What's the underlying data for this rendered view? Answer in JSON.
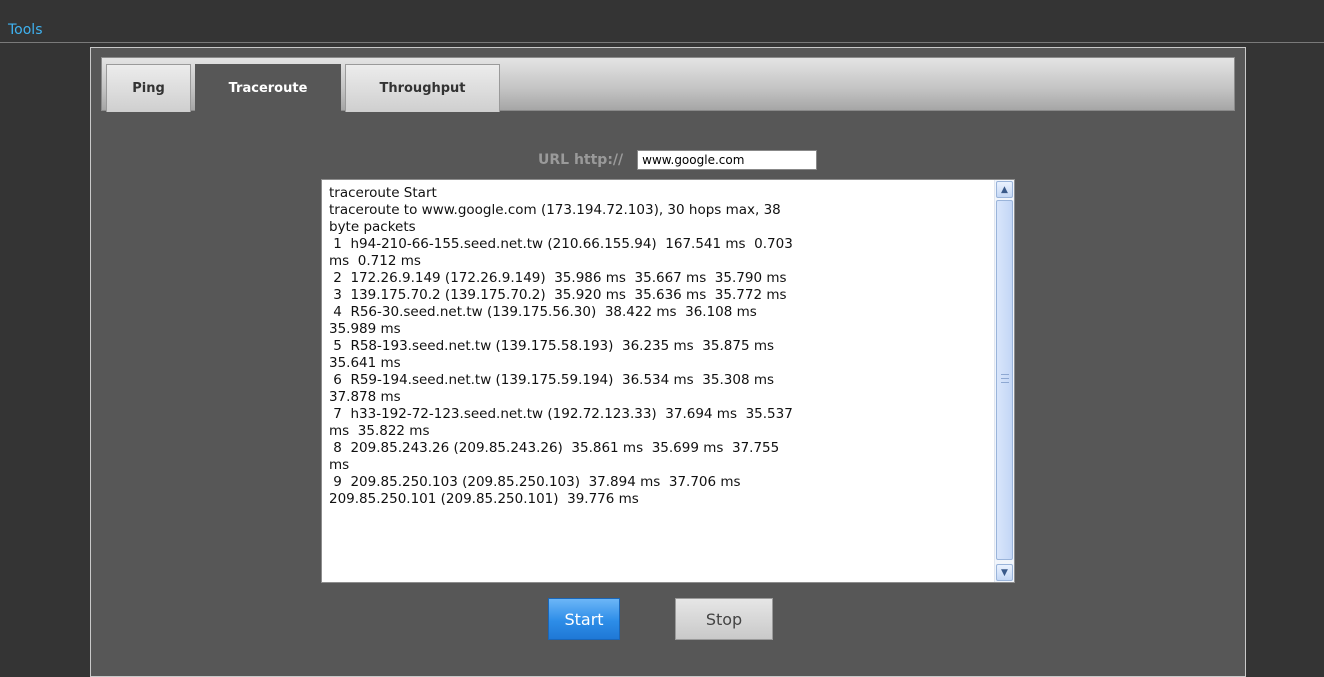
{
  "header": {
    "title": "Tools"
  },
  "tabs": [
    {
      "label": "Ping"
    },
    {
      "label": "Traceroute"
    },
    {
      "label": "Throughput"
    }
  ],
  "url": {
    "label": "URL http://",
    "value": "www.google.com"
  },
  "output_lines": [
    "traceroute Start",
    "traceroute to www.google.com (173.194.72.103), 30 hops max, 38",
    "byte packets",
    " 1  h94-210-66-155.seed.net.tw (210.66.155.94)  167.541 ms  0.703",
    "ms  0.712 ms",
    " 2  172.26.9.149 (172.26.9.149)  35.986 ms  35.667 ms  35.790 ms",
    " 3  139.175.70.2 (139.175.70.2)  35.920 ms  35.636 ms  35.772 ms",
    " 4  R56-30.seed.net.tw (139.175.56.30)  38.422 ms  36.108 ms",
    "35.989 ms",
    " 5  R58-193.seed.net.tw (139.175.58.193)  36.235 ms  35.875 ms",
    "35.641 ms",
    " 6  R59-194.seed.net.tw (139.175.59.194)  36.534 ms  35.308 ms",
    "37.878 ms",
    " 7  h33-192-72-123.seed.net.tw (192.72.123.33)  37.694 ms  35.537",
    "ms  35.822 ms",
    " 8  209.85.243.26 (209.85.243.26)  35.861 ms  35.699 ms  37.755",
    "ms",
    " 9  209.85.250.103 (209.85.250.103)  37.894 ms  37.706 ms",
    "209.85.250.101 (209.85.250.101)  39.776 ms"
  ],
  "buttons": {
    "start": "Start",
    "stop": "Stop"
  },
  "icons": {
    "scroll_up": "▲",
    "scroll_down": "▼"
  },
  "colors": {
    "title": "#3fb2f0",
    "start_button": "#2d8de8"
  }
}
